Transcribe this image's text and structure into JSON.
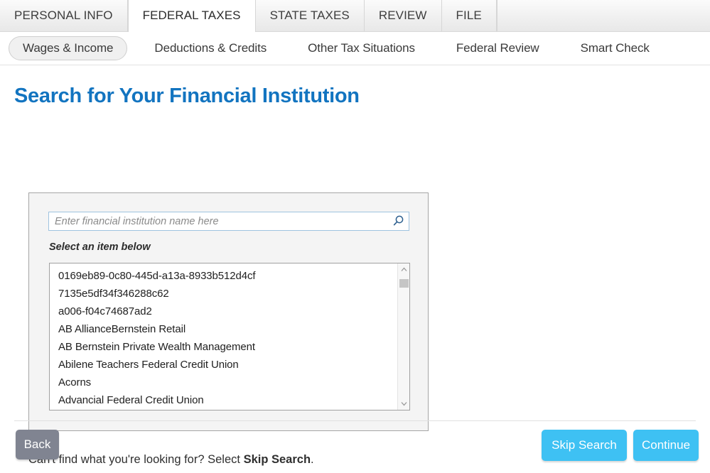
{
  "main_tabs": [
    {
      "label": "PERSONAL INFO",
      "active": false
    },
    {
      "label": "FEDERAL TAXES",
      "active": true
    },
    {
      "label": "STATE TAXES",
      "active": false
    },
    {
      "label": "REVIEW",
      "active": false
    },
    {
      "label": "FILE",
      "active": false
    }
  ],
  "sub_tabs": [
    {
      "label": "Wages & Income",
      "active": true
    },
    {
      "label": "Deductions & Credits",
      "active": false
    },
    {
      "label": "Other Tax Situations",
      "active": false
    },
    {
      "label": "Federal Review",
      "active": false
    },
    {
      "label": "Smart Check",
      "active": false
    }
  ],
  "page": {
    "title": "Search for Your Financial Institution"
  },
  "search": {
    "placeholder": "Enter financial institution name here",
    "value": "",
    "icon": "search-icon"
  },
  "list": {
    "label": "Select an item below",
    "items": [
      "0169eb89-0c80-445d-a13a-8933b512d4cf",
      "7135e5df34f346288c62",
      "a006-f04c74687ad2",
      "AB AllianceBernstein Retail",
      "AB Bernstein Private Wealth Management",
      "Abilene Teachers Federal Credit Union",
      "Acorns",
      "Advancial Federal Credit Union"
    ],
    "scrollbar": {
      "up_icon": "chevron-up-icon",
      "down_icon": "chevron-down-icon"
    }
  },
  "helper": {
    "prefix": "Can't find what you're looking for? Select ",
    "emphasis": "Skip Search",
    "suffix": "."
  },
  "footer": {
    "back_label": "Back",
    "skip_label": "Skip Search",
    "continue_label": "Continue"
  },
  "colors": {
    "title_blue": "#1274c0",
    "primary_button": "#3ec1f3",
    "back_button": "#808491",
    "panel_bg": "#f4f4f4"
  }
}
